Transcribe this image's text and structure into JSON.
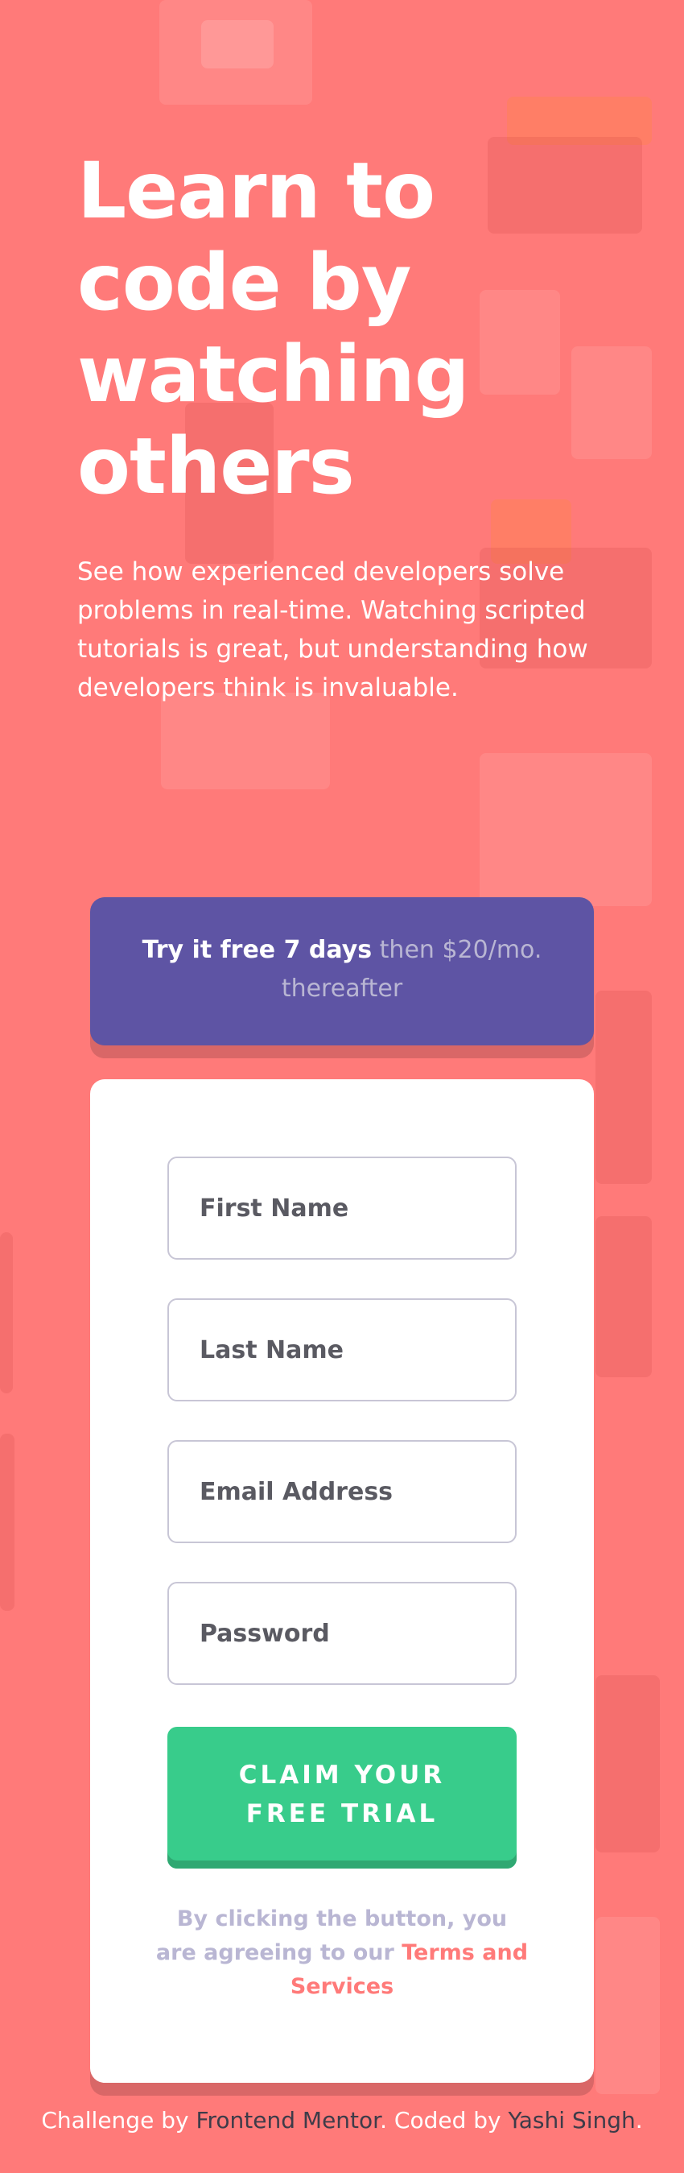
{
  "hero": {
    "title_line1": "Learn to",
    "title_line2": "code by",
    "title_line3": "watching",
    "title_line4": "others",
    "description": "See how experienced developers solve problems in real-time. Watching scripted tutorials is great, but understanding how developers think is invaluable."
  },
  "promo": {
    "strong": "Try it free 7 days",
    "rest": "then $20/mo. thereafter"
  },
  "form": {
    "first_name_placeholder": "First Name",
    "last_name_placeholder": "Last Name",
    "email_placeholder": "Email Address",
    "password_placeholder": "Password",
    "submit_label": "CLAIM YOUR FREE TRIAL",
    "terms_prefix": "By clicking the button, you are agreeing to our",
    "terms_link": "Terms and Services"
  },
  "footer": {
    "prefix": "Challenge by",
    "mentor": "Frontend Mentor",
    "middle": ". Coded by",
    "author": "Yashi Singh",
    "suffix": "."
  },
  "colors": {
    "background": "#ff7a79",
    "promo": "#5e54a4",
    "cta": "#38cc8b",
    "link": "#ff7a79",
    "muted": "#b9b6d3"
  }
}
